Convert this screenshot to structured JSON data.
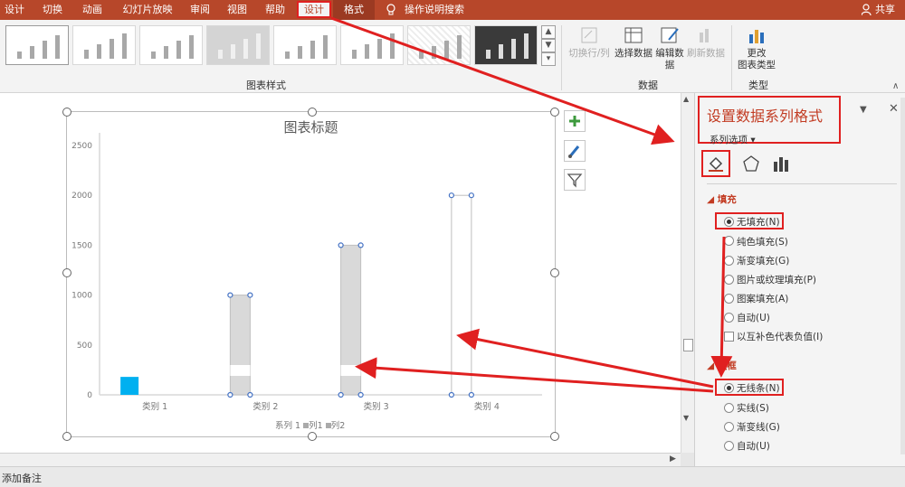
{
  "tabs": [
    {
      "label": "设计"
    },
    {
      "label": "切换"
    },
    {
      "label": "动画"
    },
    {
      "label": "幻灯片放映"
    },
    {
      "label": "审阅"
    },
    {
      "label": "视图"
    },
    {
      "label": "帮助"
    },
    {
      "label": "设计"
    },
    {
      "label": "格式"
    }
  ],
  "tell_me": "操作说明搜索",
  "share": "共享",
  "ribbon": {
    "chart_styles_label": "图表样式",
    "data_group_label": "数据",
    "type_group_label": "类型",
    "switch_row_col": "切换行/列",
    "select_data": "选择数据",
    "edit_data": "编辑数",
    "edit_data_2": "据",
    "refresh_data": "刷新数据",
    "change_type": "更改",
    "change_type_2": "图表类型"
  },
  "chart_data": {
    "type": "bar",
    "title": "图表标题",
    "categories": [
      "类别 1",
      "类别 2",
      "类别 3",
      "类别 4"
    ],
    "ylim": [
      0,
      2500
    ],
    "yticks": [
      "0",
      "500",
      "1000",
      "1500",
      "2000",
      "2500"
    ],
    "series": [
      {
        "name": "系列 1",
        "values": [
          180,
          1000,
          1500,
          2000
        ]
      }
    ],
    "legend": [
      "系列 1",
      "列1",
      "列2"
    ],
    "legend_position": "bottom",
    "grid": false
  },
  "pane": {
    "title": "设置数据系列格式",
    "series_options": "系列选项",
    "fill_section": "填充",
    "fill_options": [
      {
        "label": "无填充(N)",
        "selected": true
      },
      {
        "label": "纯色填充(S)",
        "selected": false
      },
      {
        "label": "渐变填充(G)",
        "selected": false
      },
      {
        "label": "图片或纹理填充(P)",
        "selected": false
      },
      {
        "label": "图案填充(A)",
        "selected": false
      },
      {
        "label": "自动(U)",
        "selected": false
      }
    ],
    "invert_if_negative": "以互补色代表负值(I)",
    "border_section": "边框",
    "border_options": [
      {
        "label": "无线条(N)",
        "selected": true
      },
      {
        "label": "实线(S)",
        "selected": false
      },
      {
        "label": "渐变线(G)",
        "selected": false
      },
      {
        "label": "自动(U)",
        "selected": false
      }
    ]
  },
  "notes": "添加备注",
  "colors": {
    "accent": "#b7472a",
    "highlight": "#e02020",
    "bar_fill": "#d9d9d9",
    "small_bar": "#00b0f0"
  }
}
